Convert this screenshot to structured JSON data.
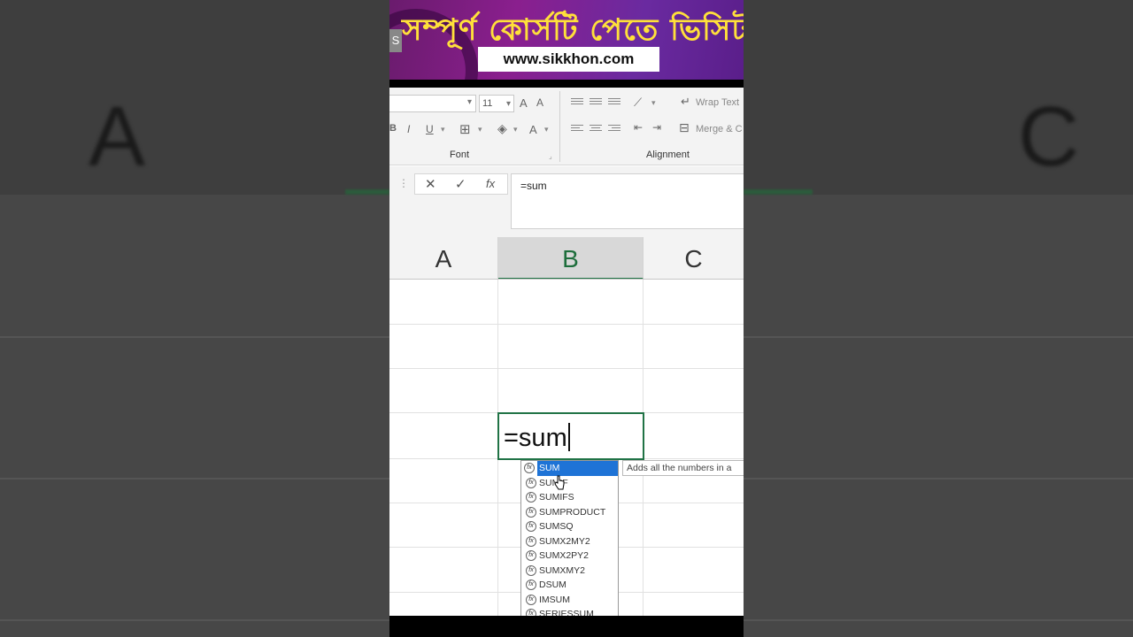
{
  "background": {
    "left_letter": "A",
    "right_letter": "C"
  },
  "banner": {
    "title": "সম্পূর্ণ কোর্সটি পেতে ভিসিট",
    "url": "www.sikkhon.com",
    "side_tab": "S"
  },
  "ribbon": {
    "font_size": "11",
    "grow_font": "A",
    "shrink_font": "A",
    "bold": "B",
    "italic": "I",
    "underline": "U",
    "font_color": "A",
    "wrap_text": "Wrap Text",
    "merge": "Merge & C",
    "font_group_label": "Font",
    "alignment_group_label": "Alignment"
  },
  "formula_bar": {
    "cancel": "✕",
    "enter": "✓",
    "function": "fx",
    "value": "=sum"
  },
  "columns": [
    "A",
    "B",
    "C"
  ],
  "selected_column": "B",
  "active_cell": {
    "value": "=sum"
  },
  "autocomplete": {
    "selected": "SUM",
    "items": [
      "SUM",
      "SUMIF",
      "SUMIFS",
      "SUMPRODUCT",
      "SUMSQ",
      "SUMX2MY2",
      "SUMX2PY2",
      "SUMXMY2",
      "DSUM",
      "IMSUM",
      "SERIESSUM"
    ],
    "tooltip": "Adds all the numbers in a"
  },
  "colors": {
    "excel_green": "#217346",
    "selection_blue": "#1e73d6",
    "banner_yellow": "#ffe03a",
    "banner_purple": "#8a1f8e"
  }
}
